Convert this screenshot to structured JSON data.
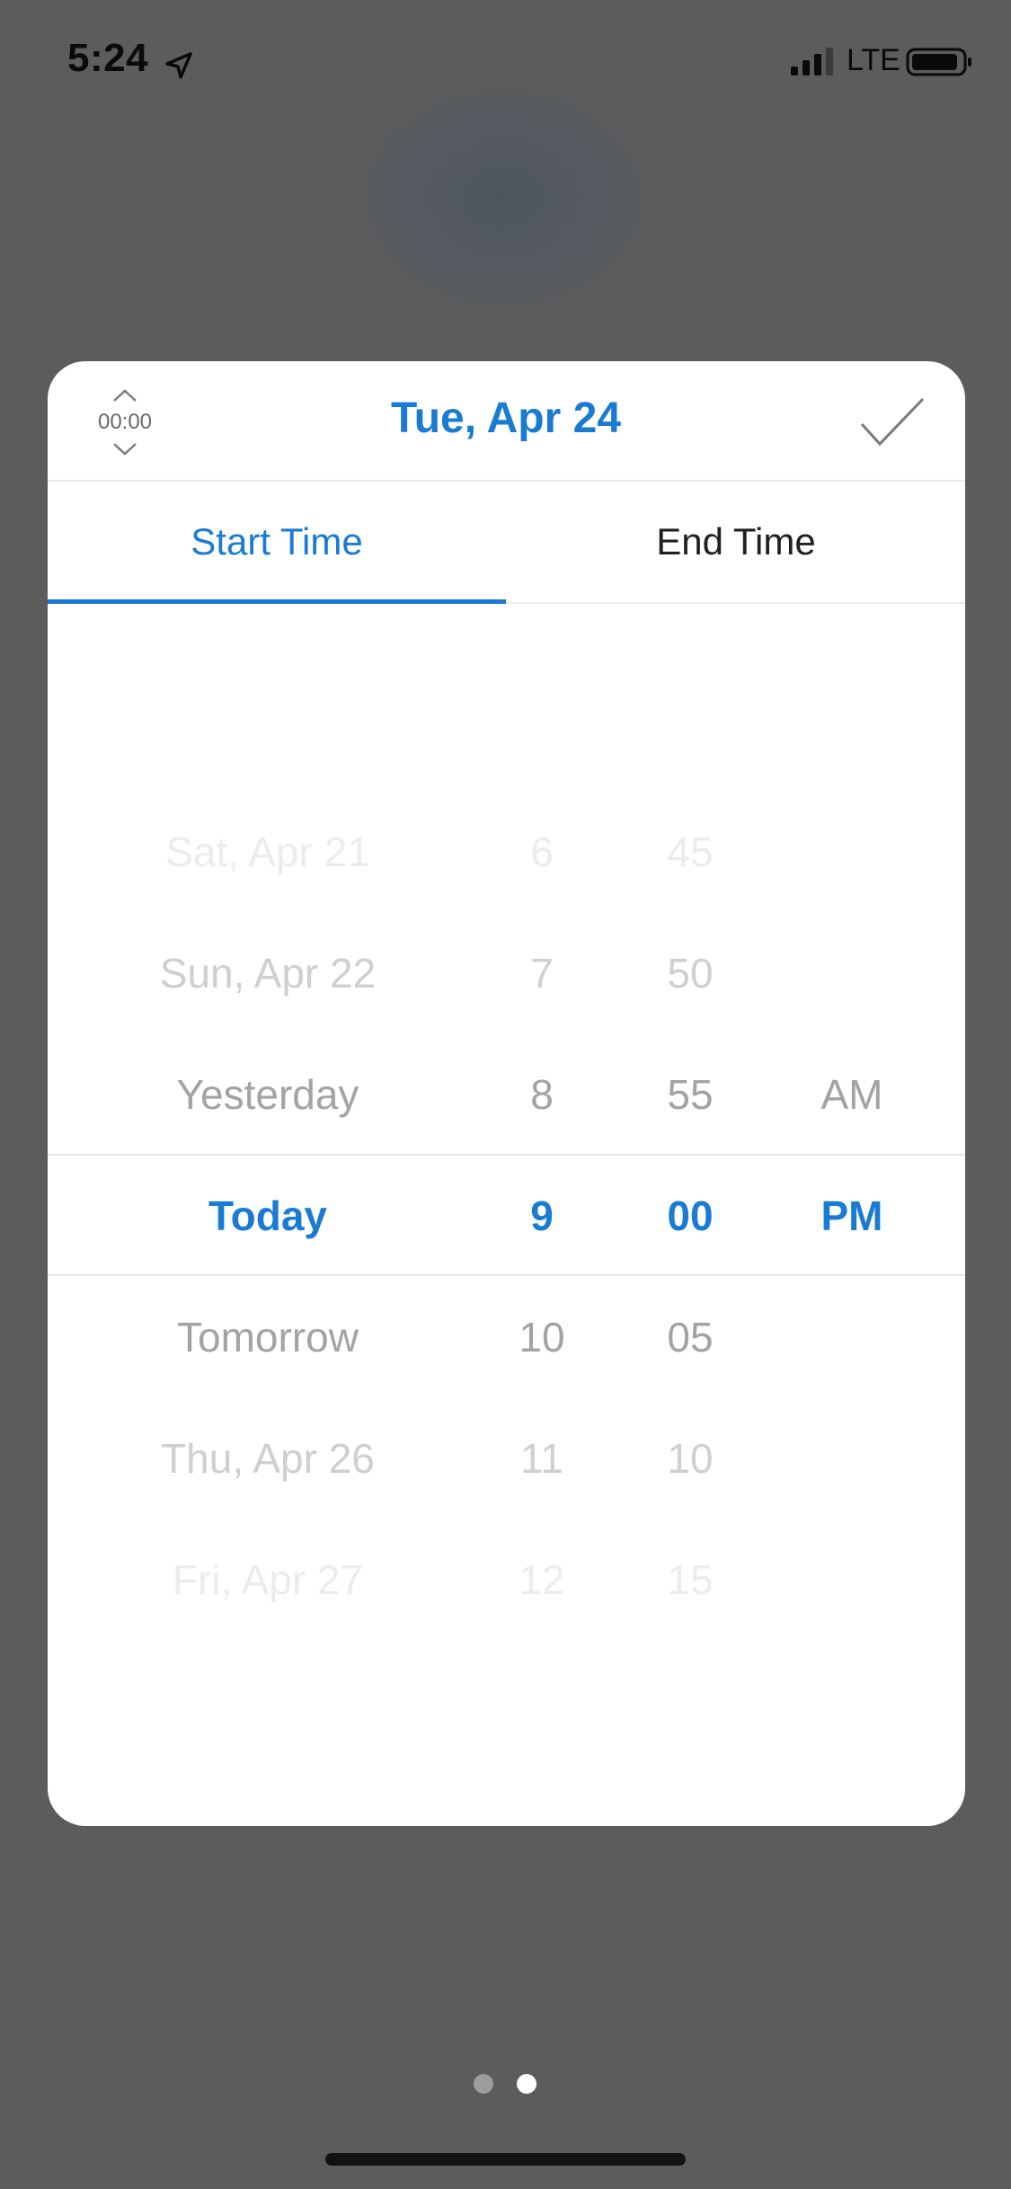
{
  "status_bar": {
    "time": "5:24",
    "carrier": "LTE",
    "icons": [
      "location-arrow-icon",
      "cellular-signal-icon",
      "battery-icon"
    ]
  },
  "modal": {
    "duration_label": "00:00",
    "title": "Tue, Apr 24",
    "confirm_icon": "checkmark-icon",
    "tabs": [
      {
        "label": "Start Time",
        "active": true
      },
      {
        "label": "End Time",
        "active": false
      }
    ]
  },
  "picker": {
    "days": [
      "Sat, Apr 21",
      "Sun, Apr 22",
      "Yesterday",
      "Today",
      "Tomorrow",
      "Thu, Apr 26",
      "Fri, Apr 27"
    ],
    "hours": [
      "6",
      "7",
      "8",
      "9",
      "10",
      "11",
      "12"
    ],
    "minutes": [
      "45",
      "50",
      "55",
      "00",
      "05",
      "10",
      "15"
    ],
    "ampm": [
      "AM",
      "PM"
    ],
    "selected": {
      "day": "Today",
      "hour": "9",
      "minute": "00",
      "ampm": "PM"
    }
  },
  "pagination": {
    "total": 2,
    "current": 2
  },
  "colors": {
    "accent": "#1a7bd3",
    "backdrop": "#5c5c5c",
    "card": "#ffffff"
  }
}
